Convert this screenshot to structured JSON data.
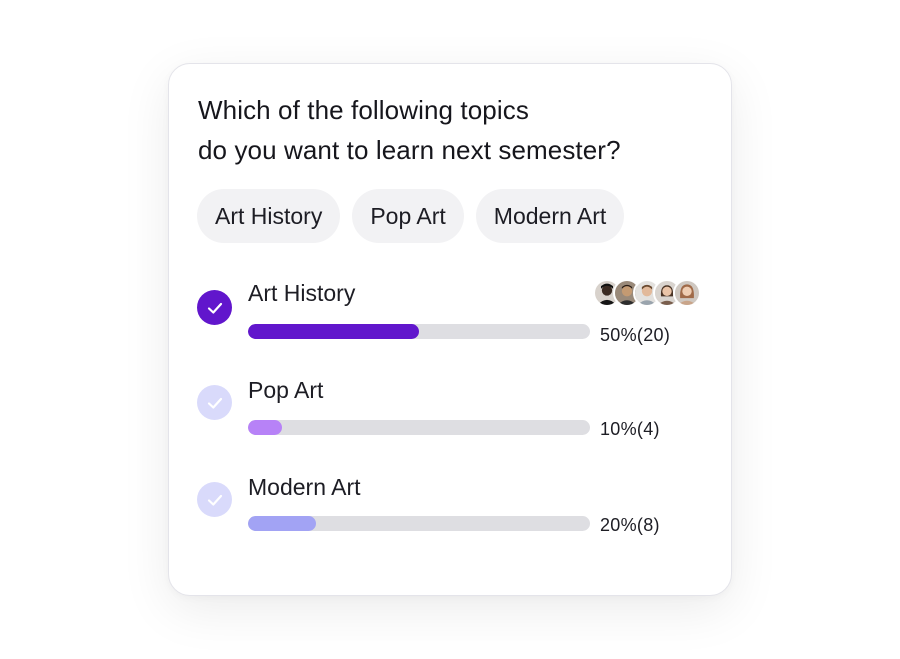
{
  "poll": {
    "question_line1": "Which of the following topics",
    "question_line2": "do you want to learn next semester?",
    "chips": [
      "Art History",
      "Pop Art",
      "Modern Art"
    ],
    "options": [
      {
        "label": "Art History",
        "result": "50%(20)",
        "percent": 50,
        "selected": true,
        "bar_color": "#6116cc",
        "check_color": "#6116cc"
      },
      {
        "label": "Pop Art",
        "result": "10%(4)",
        "percent": 10,
        "selected": false,
        "bar_color": "#b782f7",
        "check_color": "#d9dafb"
      },
      {
        "label": "Modern Art",
        "result": "20%(8)",
        "percent": 20,
        "selected": false,
        "bar_color": "#a2a3f4",
        "check_color": "#d9dafb"
      }
    ],
    "voter_avatars": [
      "voter-avatar",
      "voter-avatar",
      "voter-avatar",
      "voter-avatar",
      "voter-avatar"
    ]
  }
}
